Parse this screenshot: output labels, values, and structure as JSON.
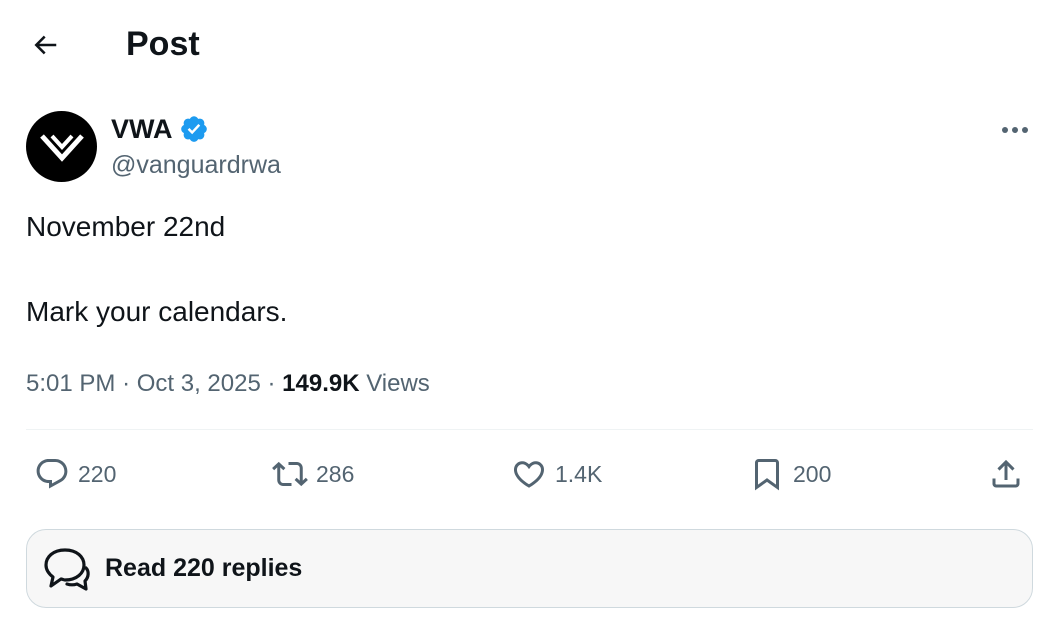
{
  "header": {
    "title": "Post",
    "back_icon": "arrow-left-icon"
  },
  "author": {
    "display_name": "VWA",
    "handle": "@vanguardrwa",
    "verified": true,
    "verified_color": "#1d9bf0",
    "avatar_icon": "vwa-logo-chevron-icon"
  },
  "tweet": {
    "line1": "November 22nd",
    "line2": "Mark your calendars."
  },
  "meta": {
    "time": "5:01 PM",
    "sep1": "·",
    "date": "Oct 3, 2025",
    "sep2": "·",
    "views_count": "149.9K",
    "views_label": "Views"
  },
  "actions": {
    "replies": "220",
    "reposts": "286",
    "likes": "1.4K",
    "bookmarks": "200"
  },
  "read_replies": {
    "label": "Read 220 replies"
  },
  "colors": {
    "text": "#0f1419",
    "secondary": "#536471",
    "accent": "#1d9bf0"
  }
}
